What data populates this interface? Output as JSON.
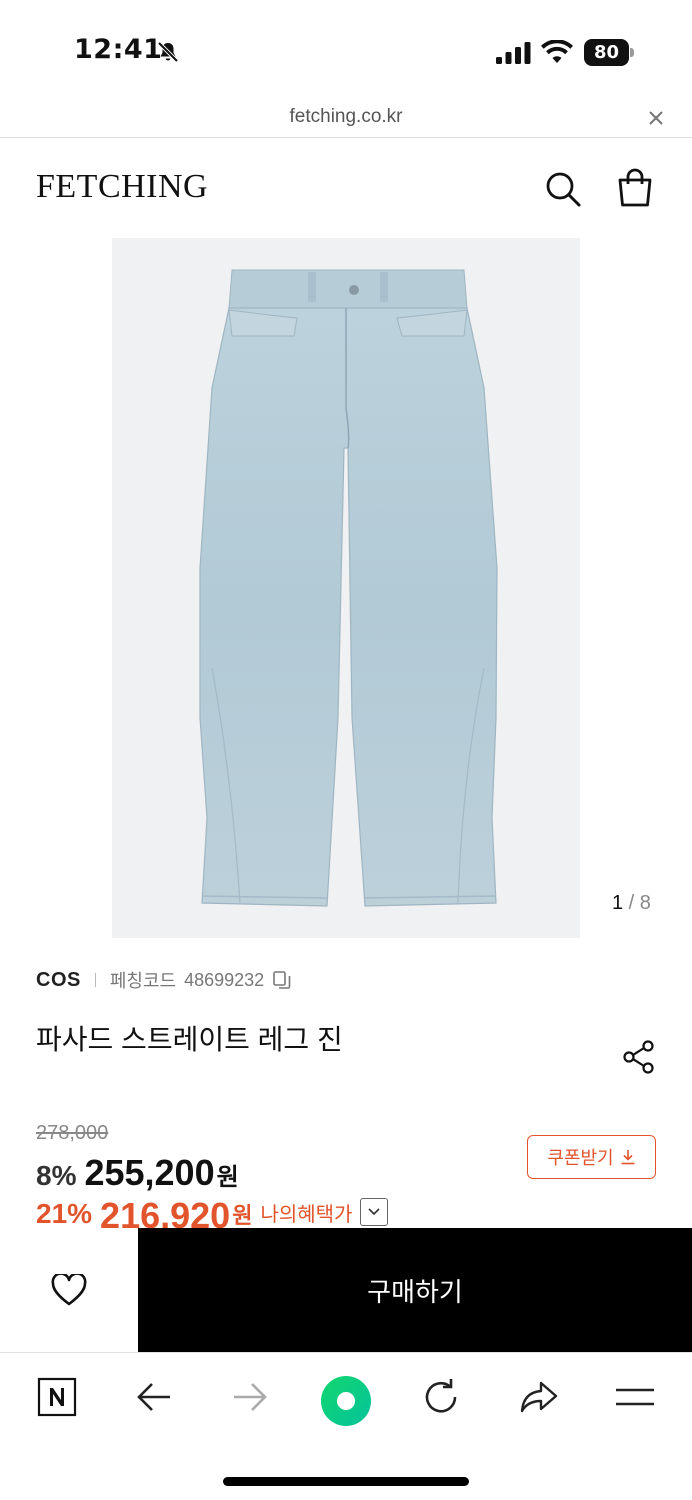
{
  "status_bar": {
    "time": "12:41",
    "battery": "80"
  },
  "browser": {
    "url": "fetching.co.kr"
  },
  "header": {
    "logo": "FETCHING"
  },
  "gallery": {
    "current": "1",
    "separator": " / ",
    "total": "8"
  },
  "product": {
    "brand": "COS",
    "code_label": "페칭코드",
    "code_value": "48699232",
    "title": "파사드 스트레이트 레그 진",
    "original_price": "278,000",
    "sale_rate": "8%",
    "sale_price": "255,200",
    "currency": "원",
    "benefit_rate": "21%",
    "benefit_price": "216,920",
    "benefit_label": "나의혜택가"
  },
  "coupon": {
    "label": "쿠폰받기"
  },
  "purchase": {
    "buy_label": "구매하기"
  },
  "colors": {
    "accent": "#e2542b",
    "denim": "#b9cfd9"
  }
}
